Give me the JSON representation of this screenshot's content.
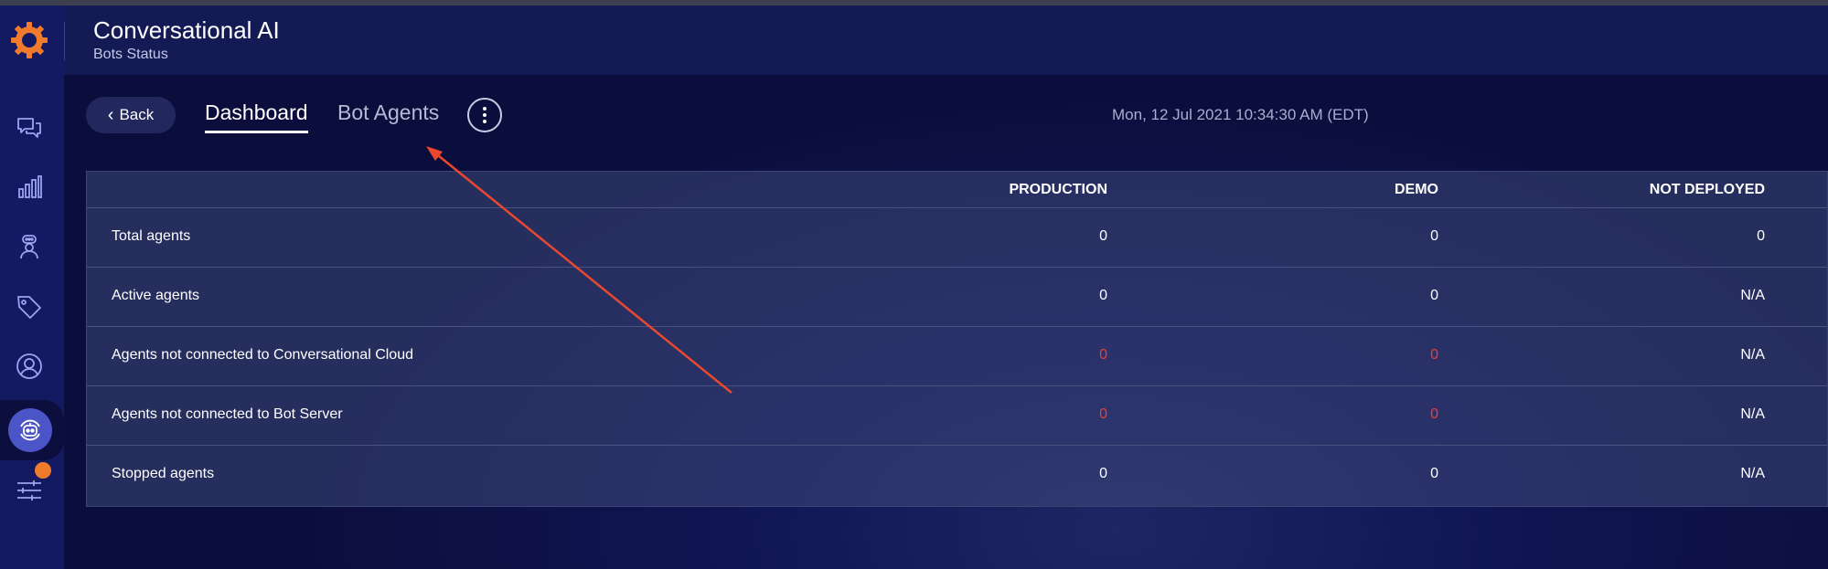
{
  "header": {
    "title": "Conversational AI",
    "subtitle": "Bots Status"
  },
  "sidebar": {
    "logo_icon": "gear-logo",
    "items": [
      {
        "icon": "chat-bubbles-icon"
      },
      {
        "icon": "bar-chart-icon"
      },
      {
        "icon": "agent-icon"
      },
      {
        "icon": "tag-icon"
      },
      {
        "icon": "user-circle-icon"
      },
      {
        "icon": "bot-icon",
        "active": true
      },
      {
        "icon": "sliders-icon",
        "notification": true
      }
    ]
  },
  "toolbar": {
    "back_label": "Back",
    "tabs": [
      {
        "label": "Dashboard",
        "active": true
      },
      {
        "label": "Bot Agents",
        "active": false
      }
    ],
    "more_icon": "more-vertical-icon",
    "timestamp": "Mon, 12 Jul 2021 10:34:30 AM (EDT)"
  },
  "table": {
    "columns": [
      "",
      "PRODUCTION",
      "DEMO",
      "NOT DEPLOYED"
    ],
    "rows": [
      {
        "label": "Total agents",
        "production": "0",
        "demo": "0",
        "not_deployed": "0"
      },
      {
        "label": "Active agents",
        "production": "0",
        "demo": "0",
        "not_deployed": "N/A"
      },
      {
        "label": "Agents not connected to Conversational Cloud",
        "production": "0",
        "demo": "0",
        "not_deployed": "N/A"
      },
      {
        "label": "Agents not connected to Bot Server",
        "production": "0",
        "demo": "0",
        "not_deployed": "N/A"
      },
      {
        "label": "Stopped agents",
        "production": "0",
        "demo": "0",
        "not_deployed": "N/A"
      }
    ]
  },
  "colors": {
    "accent_orange": "#f07b2c",
    "alert_red": "#e0423f",
    "annotation_arrow": "#e8482f"
  }
}
